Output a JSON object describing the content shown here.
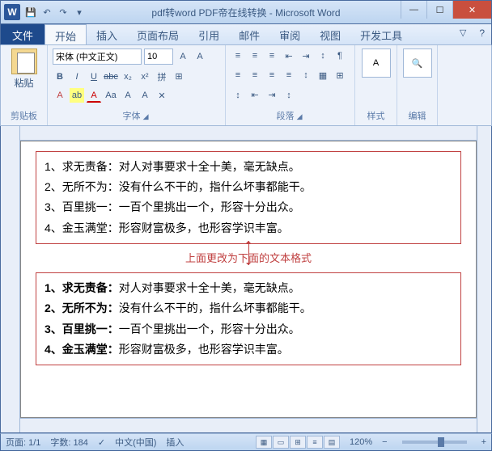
{
  "title": "pdf转word PDF帝在线转换 - Microsoft Word",
  "app_icon": "W",
  "qat": {
    "save": "💾",
    "undo": "↶",
    "redo": "↷",
    "dropdown": "▾"
  },
  "win": {
    "min": "—",
    "max": "☐",
    "close": "✕"
  },
  "tabs": {
    "file": "文件",
    "home": "开始",
    "insert": "插入",
    "layout": "页面布局",
    "reference": "引用",
    "mail": "邮件",
    "review": "审阅",
    "view": "视图",
    "dev": "开发工具"
  },
  "ribbon_controls": {
    "minimize": "▽",
    "help": "?"
  },
  "clipboard": {
    "paste": "粘贴",
    "label": "剪贴板"
  },
  "font": {
    "name": "宋体 (中文正文)",
    "size": "10",
    "grow": "A",
    "shrink": "A",
    "case": "Aa",
    "clear": "✕",
    "bold": "B",
    "italic": "I",
    "underline": "U",
    "strike": "abc",
    "sub": "x₂",
    "sup": "x²",
    "effects": "A",
    "highlight": "ab",
    "color": "A",
    "phonetic": "拼",
    "border": "⊞",
    "label": "字体"
  },
  "para": {
    "bullets": "≡",
    "numbers": "≡",
    "multilevel": "≡",
    "dedent": "⇤",
    "indent": "⇥",
    "sort": "↕",
    "marks": "¶",
    "left": "≡",
    "center": "≡",
    "right": "≡",
    "justify": "≡",
    "spacing": "↕",
    "shading": "▦",
    "borders": "⊞",
    "label": "段落"
  },
  "styles": {
    "label": "样式",
    "icon": "A"
  },
  "editing": {
    "label": "编辑",
    "find": "🔍"
  },
  "doc": {
    "items1": [
      {
        "n": "1、",
        "t": "求无责备：",
        "d": "对人对事要求十全十美，毫无缺点。"
      },
      {
        "n": "2、",
        "t": "无所不为：",
        "d": "没有什么不干的，指什么坏事都能干。"
      },
      {
        "n": "3、",
        "t": "百里挑一：",
        "d": "一百个里挑出一个，形容十分出众。"
      },
      {
        "n": "4、",
        "t": "金玉满堂：",
        "d": "形容财富极多，也形容学识丰富。"
      }
    ],
    "anno": "上面更改为下面的文本格式",
    "items2": [
      {
        "n": "1、",
        "t": "求无责备：",
        "d": "对人对事要求十全十美，毫无缺点。"
      },
      {
        "n": "2、",
        "t": "无所不为：",
        "d": "没有什么不干的，指什么坏事都能干。"
      },
      {
        "n": "3、",
        "t": "百里挑一：",
        "d": "一百个里挑出一个，形容十分出众。"
      },
      {
        "n": "4、",
        "t": "金玉满堂：",
        "d": "形容财富极多，也形容学识丰富。"
      }
    ]
  },
  "status": {
    "page": "页面: 1/1",
    "words": "字数: 184",
    "lang": "中文(中国)",
    "insert": "插入",
    "zoom": "120%",
    "zoom_minus": "−",
    "zoom_plus": "+"
  }
}
